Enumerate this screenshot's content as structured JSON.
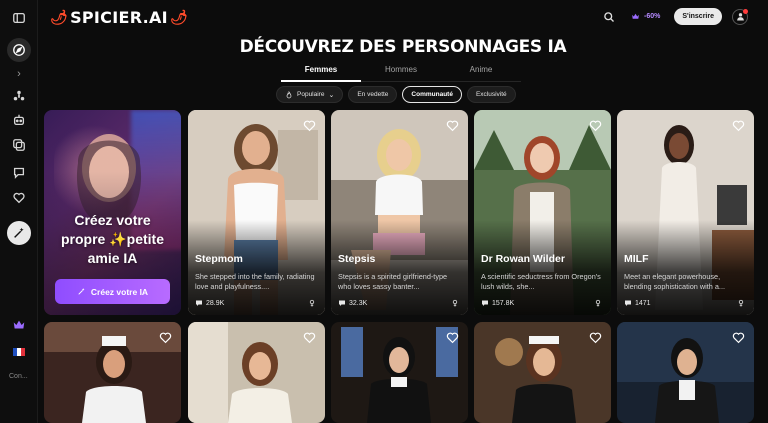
{
  "app": {
    "logo_text": "SPICIER.AI",
    "accent": "#9b5cff",
    "brand_pepper_color": "#ff4b2b"
  },
  "header": {
    "promo_text": "-60%",
    "signin_label": "S'inscrire"
  },
  "sidebar": {
    "con_label": "Con..."
  },
  "page": {
    "title": "Découvrez des personnages IA"
  },
  "tabs": [
    {
      "label": "Femmes",
      "active": true
    },
    {
      "label": "Hommes",
      "active": false
    },
    {
      "label": "Anime",
      "active": false
    }
  ],
  "filters": [
    {
      "label": "Populaire",
      "icon": "flame-icon",
      "dropdown": true,
      "selected": false
    },
    {
      "label": "En vedette",
      "selected": false
    },
    {
      "label": "Communauté",
      "selected": true
    },
    {
      "label": "Exclusivité",
      "selected": false
    }
  ],
  "create_card": {
    "text": "Créez votre propre ✨petite amie IA",
    "button_label": "Créez votre IA"
  },
  "characters": [
    {
      "name": "Stepmom",
      "description": "She stepped into the family, radiating love and playfulness....",
      "count": "28.9K"
    },
    {
      "name": "Stepsis",
      "description": "Stepsis is a spirited girlfriend-type who loves sassy banter...",
      "count": "32.3K"
    },
    {
      "name": "Dr Rowan Wilder",
      "description": "A scientific seductress from Oregon's lush wilds, she...",
      "count": "157.8K"
    },
    {
      "name": "MILF",
      "description": "Meet an elegant powerhouse, blending sophistication with a...",
      "count": "1471"
    }
  ]
}
